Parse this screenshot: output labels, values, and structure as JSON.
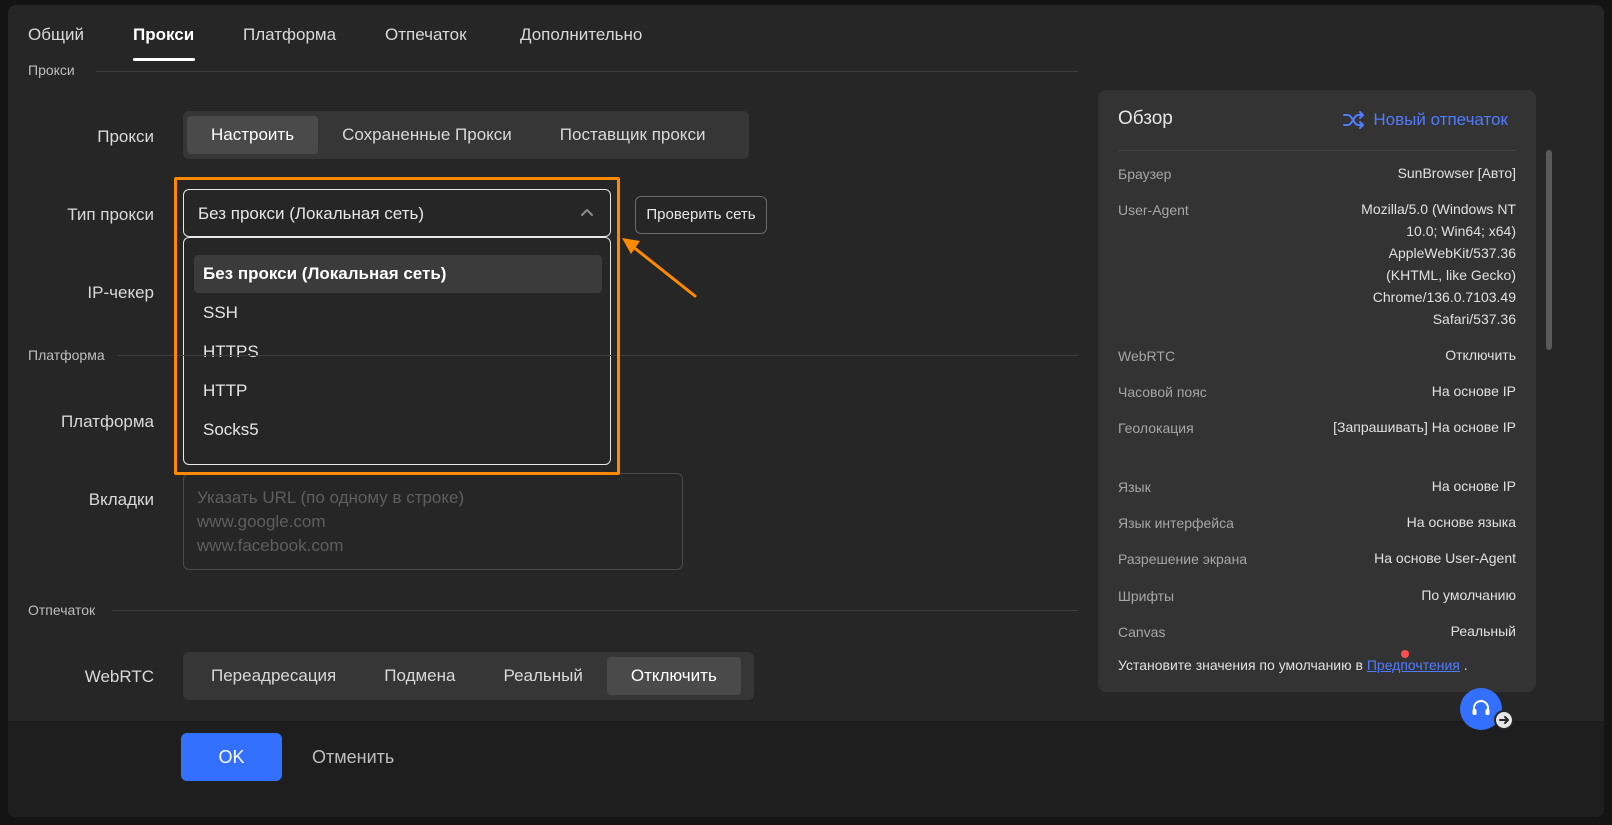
{
  "tabs": [
    {
      "label": "Общий"
    },
    {
      "label": "Прокси"
    },
    {
      "label": "Платформа"
    },
    {
      "label": "Отпечаток"
    },
    {
      "label": "Дополнительно"
    }
  ],
  "sections": {
    "proxy": "Прокси",
    "platform": "Платформа",
    "fingerprint": "Отпечаток"
  },
  "proxy": {
    "label": "Прокси",
    "modes": [
      "Настроить",
      "Сохраненные Прокси",
      "Поставщик прокси"
    ],
    "type_label": "Тип прокси",
    "type_value": "Без прокси (Локальная сеть)",
    "type_options": [
      "Без прокси (Локальная сеть)",
      "SSH",
      "HTTPS",
      "HTTP",
      "Socks5"
    ],
    "check_button": "Проверить сеть",
    "ip_checker_label": "IP-чекер"
  },
  "platform": {
    "label": "Платформа",
    "tabs_label": "Вкладки",
    "tabs_placeholder": "Указать URL (по одному в строке)\nwww.google.com\nwww.facebook.com"
  },
  "fingerprint": {
    "webrtc_label": "WebRTC",
    "webrtc_options": [
      "Переадресация",
      "Подмена",
      "Реальный",
      "Отключить"
    ]
  },
  "footer": {
    "ok": "OK",
    "cancel": "Отменить"
  },
  "overview": {
    "title": "Обзор",
    "new_fingerprint": "Новый отпечаток",
    "rows": [
      {
        "key": "Браузер",
        "value": "SunBrowser [Авто]"
      },
      {
        "key": "User-Agent",
        "value": "Mozilla/5.0 (Windows NT 10.0; Win64; x64) AppleWebKit/537.36 (KHTML, like Gecko) Chrome/136.0.7103.49 Safari/537.36"
      },
      {
        "key": "WebRTC",
        "value": "Отключить"
      },
      {
        "key": "Часовой пояс",
        "value": "На основе IP"
      },
      {
        "key": "Геолокация",
        "value": "[Запрашивать] На основе IP"
      },
      {
        "key": "Язык",
        "value": "На основе IP"
      },
      {
        "key": "Язык интерфейса",
        "value": "На основе языка"
      },
      {
        "key": "Разрешение экрана",
        "value": "На основе User-Agent"
      },
      {
        "key": "Шрифты",
        "value": "По умолчанию"
      },
      {
        "key": "Canvas",
        "value": "Реальный"
      }
    ],
    "footer_text": "Установите значения по умолчанию в ",
    "footer_link": "Предпочтения",
    "footer_end": " ."
  },
  "colors": {
    "accent": "#3370ff",
    "highlight": "#ff8a00",
    "background": "#262626"
  }
}
